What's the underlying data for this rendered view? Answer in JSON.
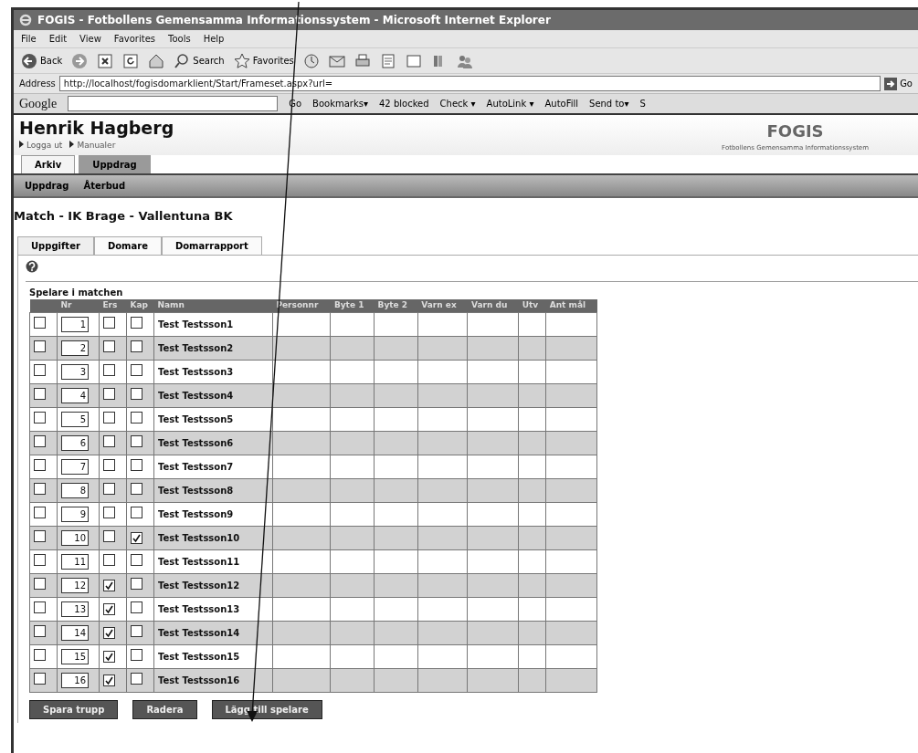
{
  "window": {
    "title": "FOGIS - Fotbollens Gemensamma Informationssystem - Microsoft Internet Explorer"
  },
  "menu": [
    "File",
    "Edit",
    "View",
    "Favorites",
    "Tools",
    "Help"
  ],
  "toolbar": [
    {
      "kind": "back",
      "label": "Back"
    },
    {
      "kind": "forward"
    },
    {
      "kind": "stop"
    },
    {
      "kind": "refresh"
    },
    {
      "kind": "home"
    },
    {
      "kind": "search",
      "label": "Search"
    },
    {
      "kind": "favorites",
      "label": "Favorites"
    },
    {
      "kind": "history"
    },
    {
      "kind": "mail"
    },
    {
      "kind": "print"
    },
    {
      "kind": "edit"
    },
    {
      "kind": "discuss"
    },
    {
      "kind": "research"
    },
    {
      "kind": "messenger"
    }
  ],
  "address": {
    "label": "Address",
    "value": "http://localhost/fogisdomarklient/Start/Frameset.aspx?url=",
    "go": "Go"
  },
  "google_bar": {
    "logo": "Google",
    "items": [
      "Go",
      "Bookmarks▾",
      "42 blocked",
      "Check ▾",
      "AutoLink ▾",
      "AutoFill",
      "Send to▾",
      "S"
    ]
  },
  "header": {
    "user": "Henrik Hagberg",
    "links": [
      "Logga ut",
      "Manualer"
    ],
    "logo": "FOGIS",
    "logo_subtitle": "Fotbollens Gemensamma Informationssystem"
  },
  "main_tabs": [
    {
      "label": "Arkiv",
      "selected": false
    },
    {
      "label": "Uppdrag",
      "selected": true
    }
  ],
  "sub_nav": [
    "Uppdrag",
    "Återbud"
  ],
  "match_title": "Match - IK Brage - Vallentuna BK",
  "match_tabs": [
    {
      "label": "Uppgifter",
      "selected": true
    },
    {
      "label": "Domare",
      "selected": false
    },
    {
      "label": "Domarrapport",
      "selected": false
    }
  ],
  "panel_title": "Spelare i matchen",
  "table": {
    "columns": [
      "",
      "Nr",
      "Ers",
      "Kap",
      "Namn",
      "Personnr",
      "Byte 1",
      "Byte 2",
      "Varn ex",
      "Varn du",
      "Utv",
      "Ant mål"
    ],
    "rows": [
      {
        "checked": false,
        "nr": "1",
        "ers": false,
        "kap": false,
        "name": "Test Testsson1"
      },
      {
        "checked": false,
        "nr": "2",
        "ers": false,
        "kap": false,
        "name": "Test Testsson2"
      },
      {
        "checked": false,
        "nr": "3",
        "ers": false,
        "kap": false,
        "name": "Test Testsson3"
      },
      {
        "checked": false,
        "nr": "4",
        "ers": false,
        "kap": false,
        "name": "Test Testsson4"
      },
      {
        "checked": false,
        "nr": "5",
        "ers": false,
        "kap": false,
        "name": "Test Testsson5"
      },
      {
        "checked": false,
        "nr": "6",
        "ers": false,
        "kap": false,
        "name": "Test Testsson6"
      },
      {
        "checked": false,
        "nr": "7",
        "ers": false,
        "kap": false,
        "name": "Test Testsson7"
      },
      {
        "checked": false,
        "nr": "8",
        "ers": false,
        "kap": false,
        "name": "Test Testsson8"
      },
      {
        "checked": false,
        "nr": "9",
        "ers": false,
        "kap": false,
        "name": "Test Testsson9"
      },
      {
        "checked": false,
        "nr": "10",
        "ers": false,
        "kap": true,
        "name": "Test Testsson10"
      },
      {
        "checked": false,
        "nr": "11",
        "ers": false,
        "kap": false,
        "name": "Test Testsson11"
      },
      {
        "checked": false,
        "nr": "12",
        "ers": true,
        "kap": false,
        "name": "Test Testsson12"
      },
      {
        "checked": false,
        "nr": "13",
        "ers": true,
        "kap": false,
        "name": "Test Testsson13"
      },
      {
        "checked": false,
        "nr": "14",
        "ers": true,
        "kap": false,
        "name": "Test Testsson14"
      },
      {
        "checked": false,
        "nr": "15",
        "ers": true,
        "kap": false,
        "name": "Test Testsson15"
      },
      {
        "checked": false,
        "nr": "16",
        "ers": true,
        "kap": false,
        "name": "Test Testsson16"
      }
    ]
  },
  "buttons": [
    "Spara trupp",
    "Radera",
    "Lägg till spelare"
  ]
}
